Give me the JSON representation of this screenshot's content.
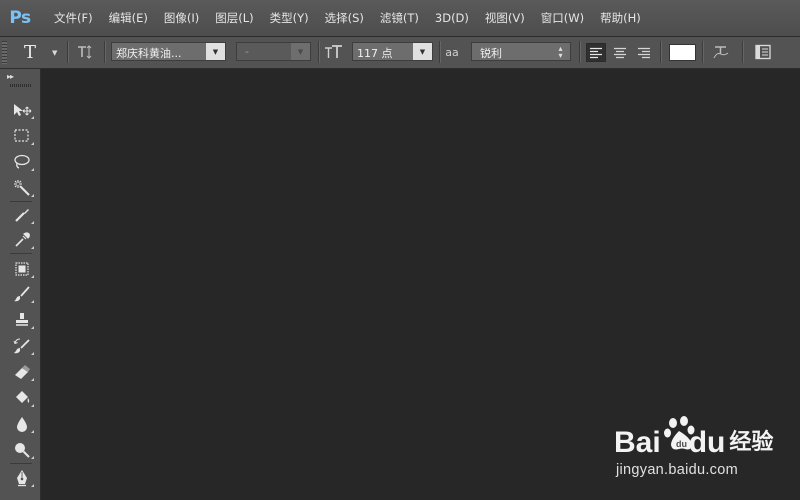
{
  "app": {
    "logo": "Ps"
  },
  "menu": [
    {
      "label": "文件(F)"
    },
    {
      "label": "编辑(E)"
    },
    {
      "label": "图像(I)"
    },
    {
      "label": "图层(L)"
    },
    {
      "label": "类型(Y)"
    },
    {
      "label": "选择(S)"
    },
    {
      "label": "滤镜(T)"
    },
    {
      "label": "3D(D)"
    },
    {
      "label": "视图(V)"
    },
    {
      "label": "窗口(W)"
    },
    {
      "label": "帮助(H)"
    }
  ],
  "options": {
    "tool_glyph": "T",
    "font_family": "郑庆科黄油...",
    "font_style": "-",
    "font_size": "117 点",
    "aa_label": "aa",
    "antialias": "锐利",
    "text_color": "#ffffff"
  },
  "tools": [
    "move-tool-icon",
    "marquee-tool-icon",
    "lasso-tool-icon",
    "magic-wand-tool-icon",
    "crop-tool-icon",
    "eyedropper-tool-icon",
    "healing-brush-tool-icon",
    "brush-tool-icon",
    "clone-stamp-tool-icon",
    "history-brush-tool-icon",
    "eraser-tool-icon",
    "paint-bucket-tool-icon",
    "blur-tool-icon",
    "dodge-tool-icon",
    "pen-tool-icon"
  ],
  "watermark": {
    "brand": "Bai",
    "brand_tail": "du",
    "product": "经验",
    "url": "jingyan.baidu.com"
  }
}
